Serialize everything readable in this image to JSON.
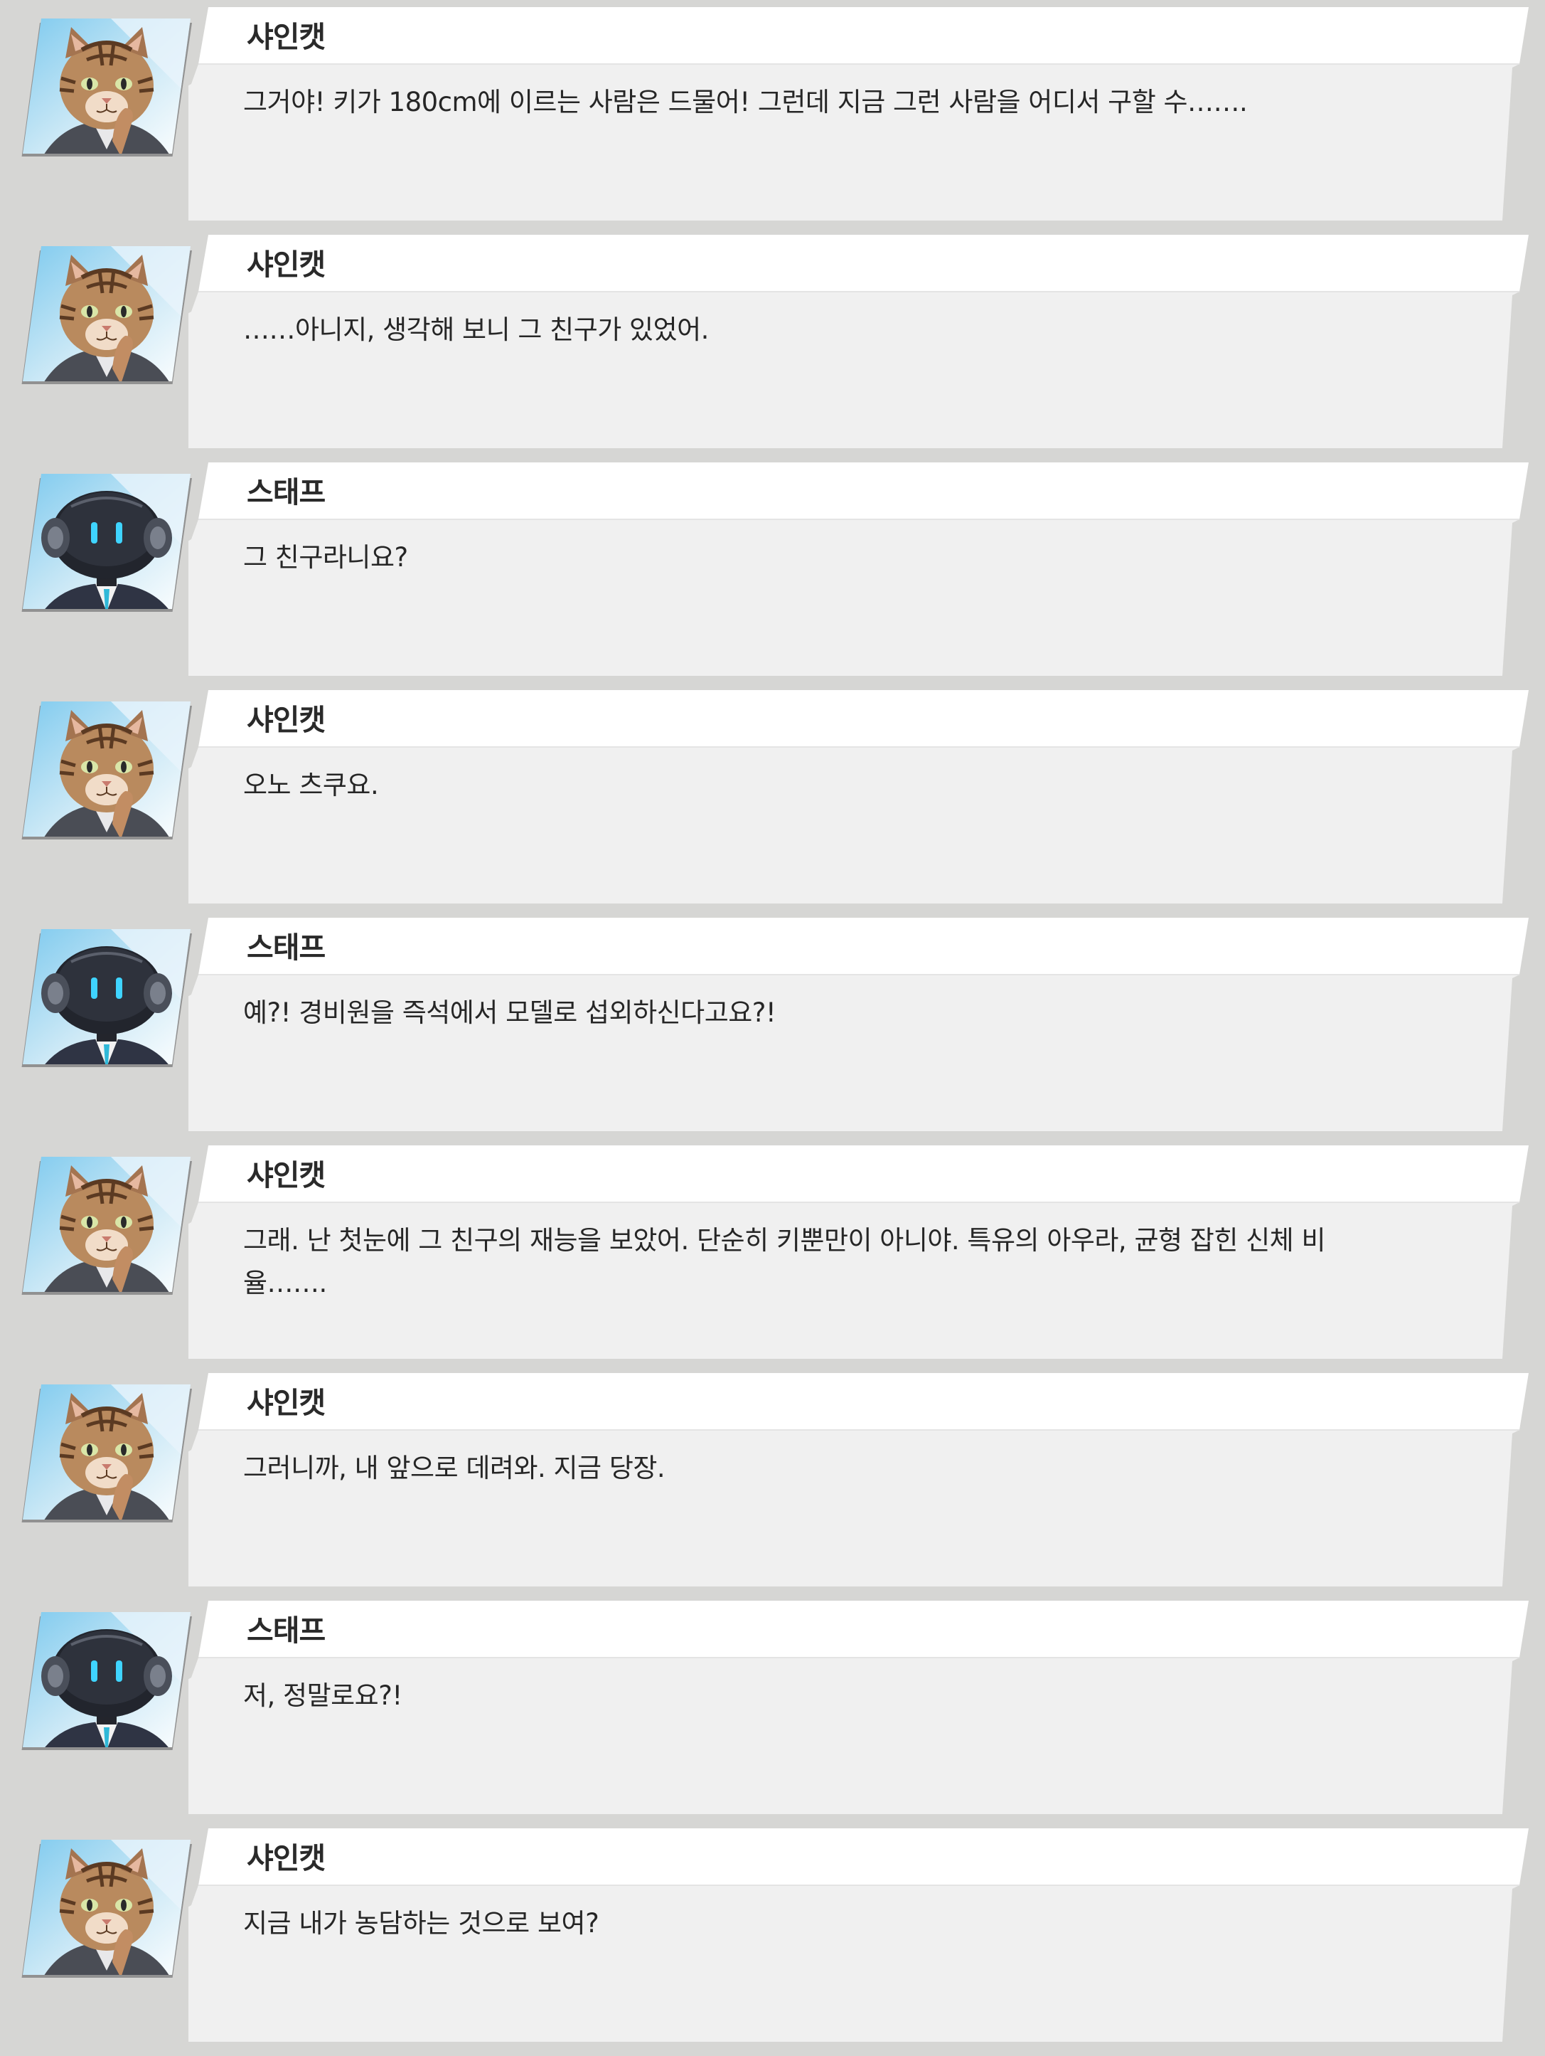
{
  "dialogue": [
    {
      "speaker": "샤인캣",
      "portrait": "cat-portrait-icon",
      "text": "그거야! 키가 180cm에 이르는 사람은 드물어! 그런데 지금 그런 사람을 어디서 구할 수……."
    },
    {
      "speaker": "샤인캣",
      "portrait": "cat-portrait-icon",
      "text": "……아니지, 생각해 보니 그 친구가 있었어."
    },
    {
      "speaker": "스태프",
      "portrait": "robot-staff-portrait-icon",
      "text": "그 친구라니요?"
    },
    {
      "speaker": "샤인캣",
      "portrait": "cat-portrait-icon",
      "text": "오노 츠쿠요."
    },
    {
      "speaker": "스태프",
      "portrait": "robot-staff-portrait-icon",
      "text": "예?! 경비원을 즉석에서 모델로 섭외하신다고요?!"
    },
    {
      "speaker": "샤인캣",
      "portrait": "cat-portrait-icon",
      "text": "그래. 난 첫눈에 그 친구의 재능을 보았어. 단순히 키뿐만이 아니야. 특유의 아우라, 균형 잡힌 신체 비율……."
    },
    {
      "speaker": "샤인캣",
      "portrait": "cat-portrait-icon",
      "text": "그러니까, 내 앞으로 데려와. 지금 당장."
    },
    {
      "speaker": "스태프",
      "portrait": "robot-staff-portrait-icon",
      "text": "저, 정말로요?!"
    },
    {
      "speaker": "샤인캣",
      "portrait": "cat-portrait-icon",
      "text": "지금 내가 농담하는 것으로 보여?"
    }
  ],
  "colors": {
    "background": "#d6d6d4",
    "bubble_header": "#ffffff",
    "bubble_body": "#f0f0f0",
    "speaker_text": "#2a2a2a",
    "line_text": "#262626"
  }
}
